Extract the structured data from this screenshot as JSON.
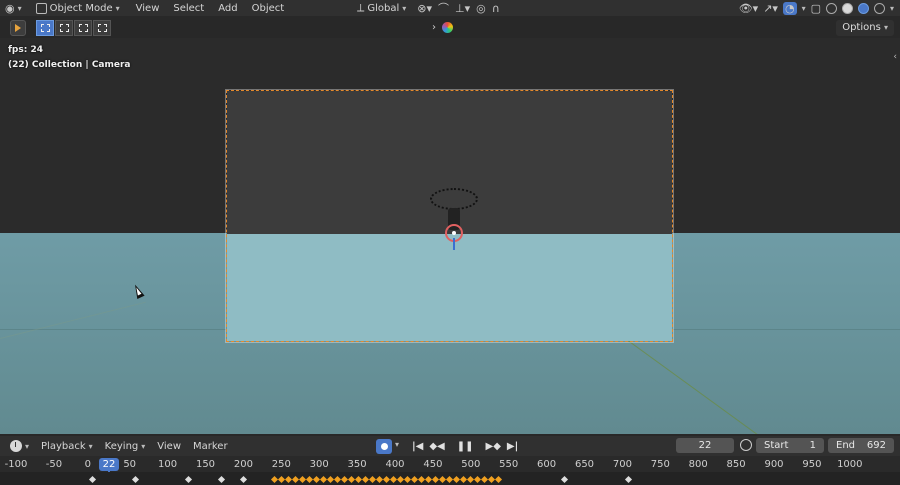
{
  "header": {
    "editor_icon": "globe-editor-icon",
    "mode": "Object Mode",
    "menus": [
      "View",
      "Select",
      "Add",
      "Object"
    ],
    "orientation": "Global",
    "options_label": "Options"
  },
  "overlay": {
    "fps": "fps: 24",
    "collection": "(22) Collection | Camera"
  },
  "timeline": {
    "menus": [
      "Playback",
      "Keying",
      "View",
      "Marker"
    ],
    "current_frame": "22",
    "start_label": "Start",
    "start_value": "1",
    "end_label": "End",
    "end_value": "692",
    "ruler_labels": [
      "-100",
      "-50",
      "0",
      "50",
      "100",
      "150",
      "200",
      "250",
      "300",
      "350",
      "400",
      "450",
      "500",
      "550",
      "600",
      "650",
      "700",
      "750",
      "800",
      "850",
      "900",
      "950",
      "1000"
    ],
    "current_frame_marker": "22"
  },
  "colors": {
    "accent": "#4a78c8",
    "camera_border": "#e58a2d",
    "keyframe_selected": "#f0a020"
  }
}
